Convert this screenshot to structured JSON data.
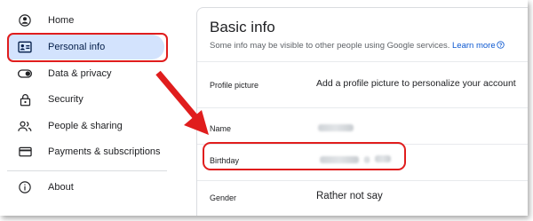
{
  "sidebar": {
    "items": [
      {
        "label": "Home",
        "icon": "account-circle-icon"
      },
      {
        "label": "Personal info",
        "icon": "id-card-icon"
      },
      {
        "label": "Data & privacy",
        "icon": "toggle-icon"
      },
      {
        "label": "Security",
        "icon": "lock-icon"
      },
      {
        "label": "People & sharing",
        "icon": "people-icon"
      },
      {
        "label": "Payments & subscriptions",
        "icon": "credit-card-icon"
      },
      {
        "label": "About",
        "icon": "info-icon"
      }
    ]
  },
  "main": {
    "title": "Basic info",
    "subtitle": "Some info may be visible to other people using Google services.",
    "learn_more": "Learn more",
    "rows": [
      {
        "label": "Profile picture",
        "value": "Add a profile picture to personalize your account"
      },
      {
        "label": "Name",
        "value": ""
      },
      {
        "label": "Birthday",
        "value": ""
      },
      {
        "label": "Gender",
        "value": "Rather not say"
      }
    ]
  },
  "colors": {
    "highlight": "#e01d1d",
    "active_nav": "#d3e3fd",
    "link": "#0b57d0"
  }
}
